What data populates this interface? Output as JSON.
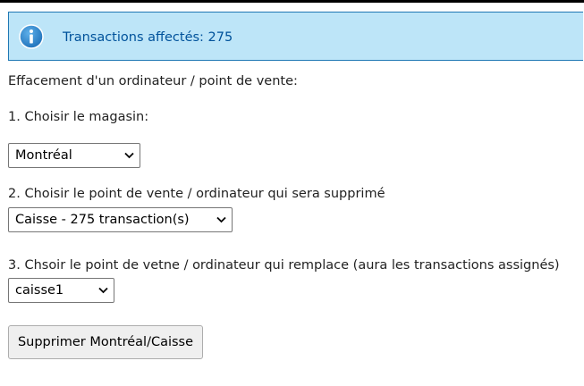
{
  "alert": {
    "icon": "info-icon",
    "message": "Transactions affectés: 275",
    "background": "#bde5f8",
    "text_color": "#00529b"
  },
  "form": {
    "heading": "Effacement d'un ordinateur / point de vente:",
    "step1": {
      "label": "1. Choisir le magasin:",
      "selected": "Montréal"
    },
    "step2": {
      "label": "2. Choisir le point de vente  / ordinateur qui sera supprimé",
      "selected": "Caisse - 275 transaction(s)"
    },
    "step3": {
      "label": "3. Chsoir le point de vetne / ordinateur qui remplace (aura les transactions assignés)",
      "selected": "caisse1"
    },
    "submit_label": "Supprimer Montréal/Caisse"
  }
}
